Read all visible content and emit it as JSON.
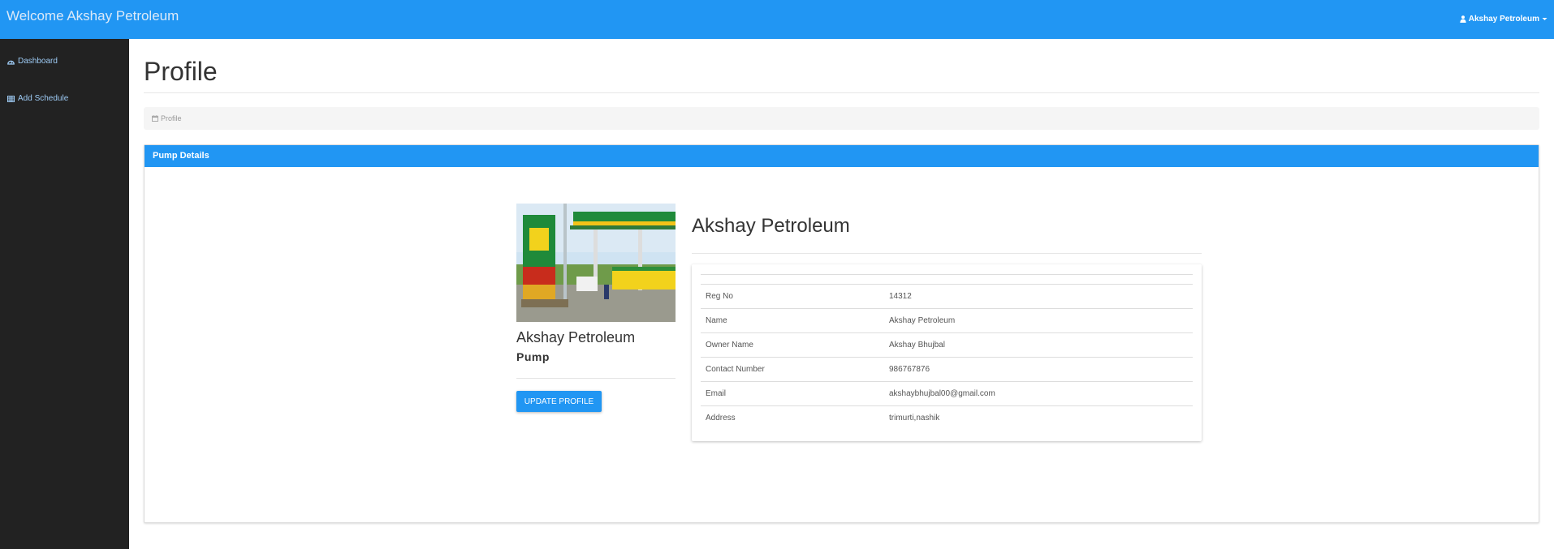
{
  "header": {
    "brand": "Welcome Akshay Petroleum",
    "user_name": "Akshay Petroleum",
    "user_icon": "user-icon",
    "caret_icon": "caret-down-icon"
  },
  "sidebar": {
    "items": [
      {
        "label": "Dashboard",
        "icon": "dashboard-icon"
      },
      {
        "label": "Add Schedule",
        "icon": "table-icon"
      }
    ]
  },
  "main": {
    "title": "Profile",
    "breadcrumb": {
      "label": "Profile",
      "icon": "calendar-icon"
    }
  },
  "panel": {
    "heading": "Pump Details",
    "card": {
      "name": "Akshay Petroleum",
      "type": "Pump",
      "button": "UPDATE PROFILE"
    },
    "detail_name": "Akshay Petroleum",
    "rows": [
      {
        "label": "Reg No",
        "value": "14312"
      },
      {
        "label": "Name",
        "value": "Akshay Petroleum"
      },
      {
        "label": "Owner Name",
        "value": "Akshay Bhujbal"
      },
      {
        "label": "Contact Number",
        "value": "986767876"
      },
      {
        "label": "Email",
        "value": "akshaybhujbal00@gmail.com"
      },
      {
        "label": "Address",
        "value": "trimurti,nashik"
      }
    ]
  },
  "colors": {
    "primary": "#2196f3",
    "sidebar_bg": "#222222",
    "link": "#9ecbf5"
  }
}
